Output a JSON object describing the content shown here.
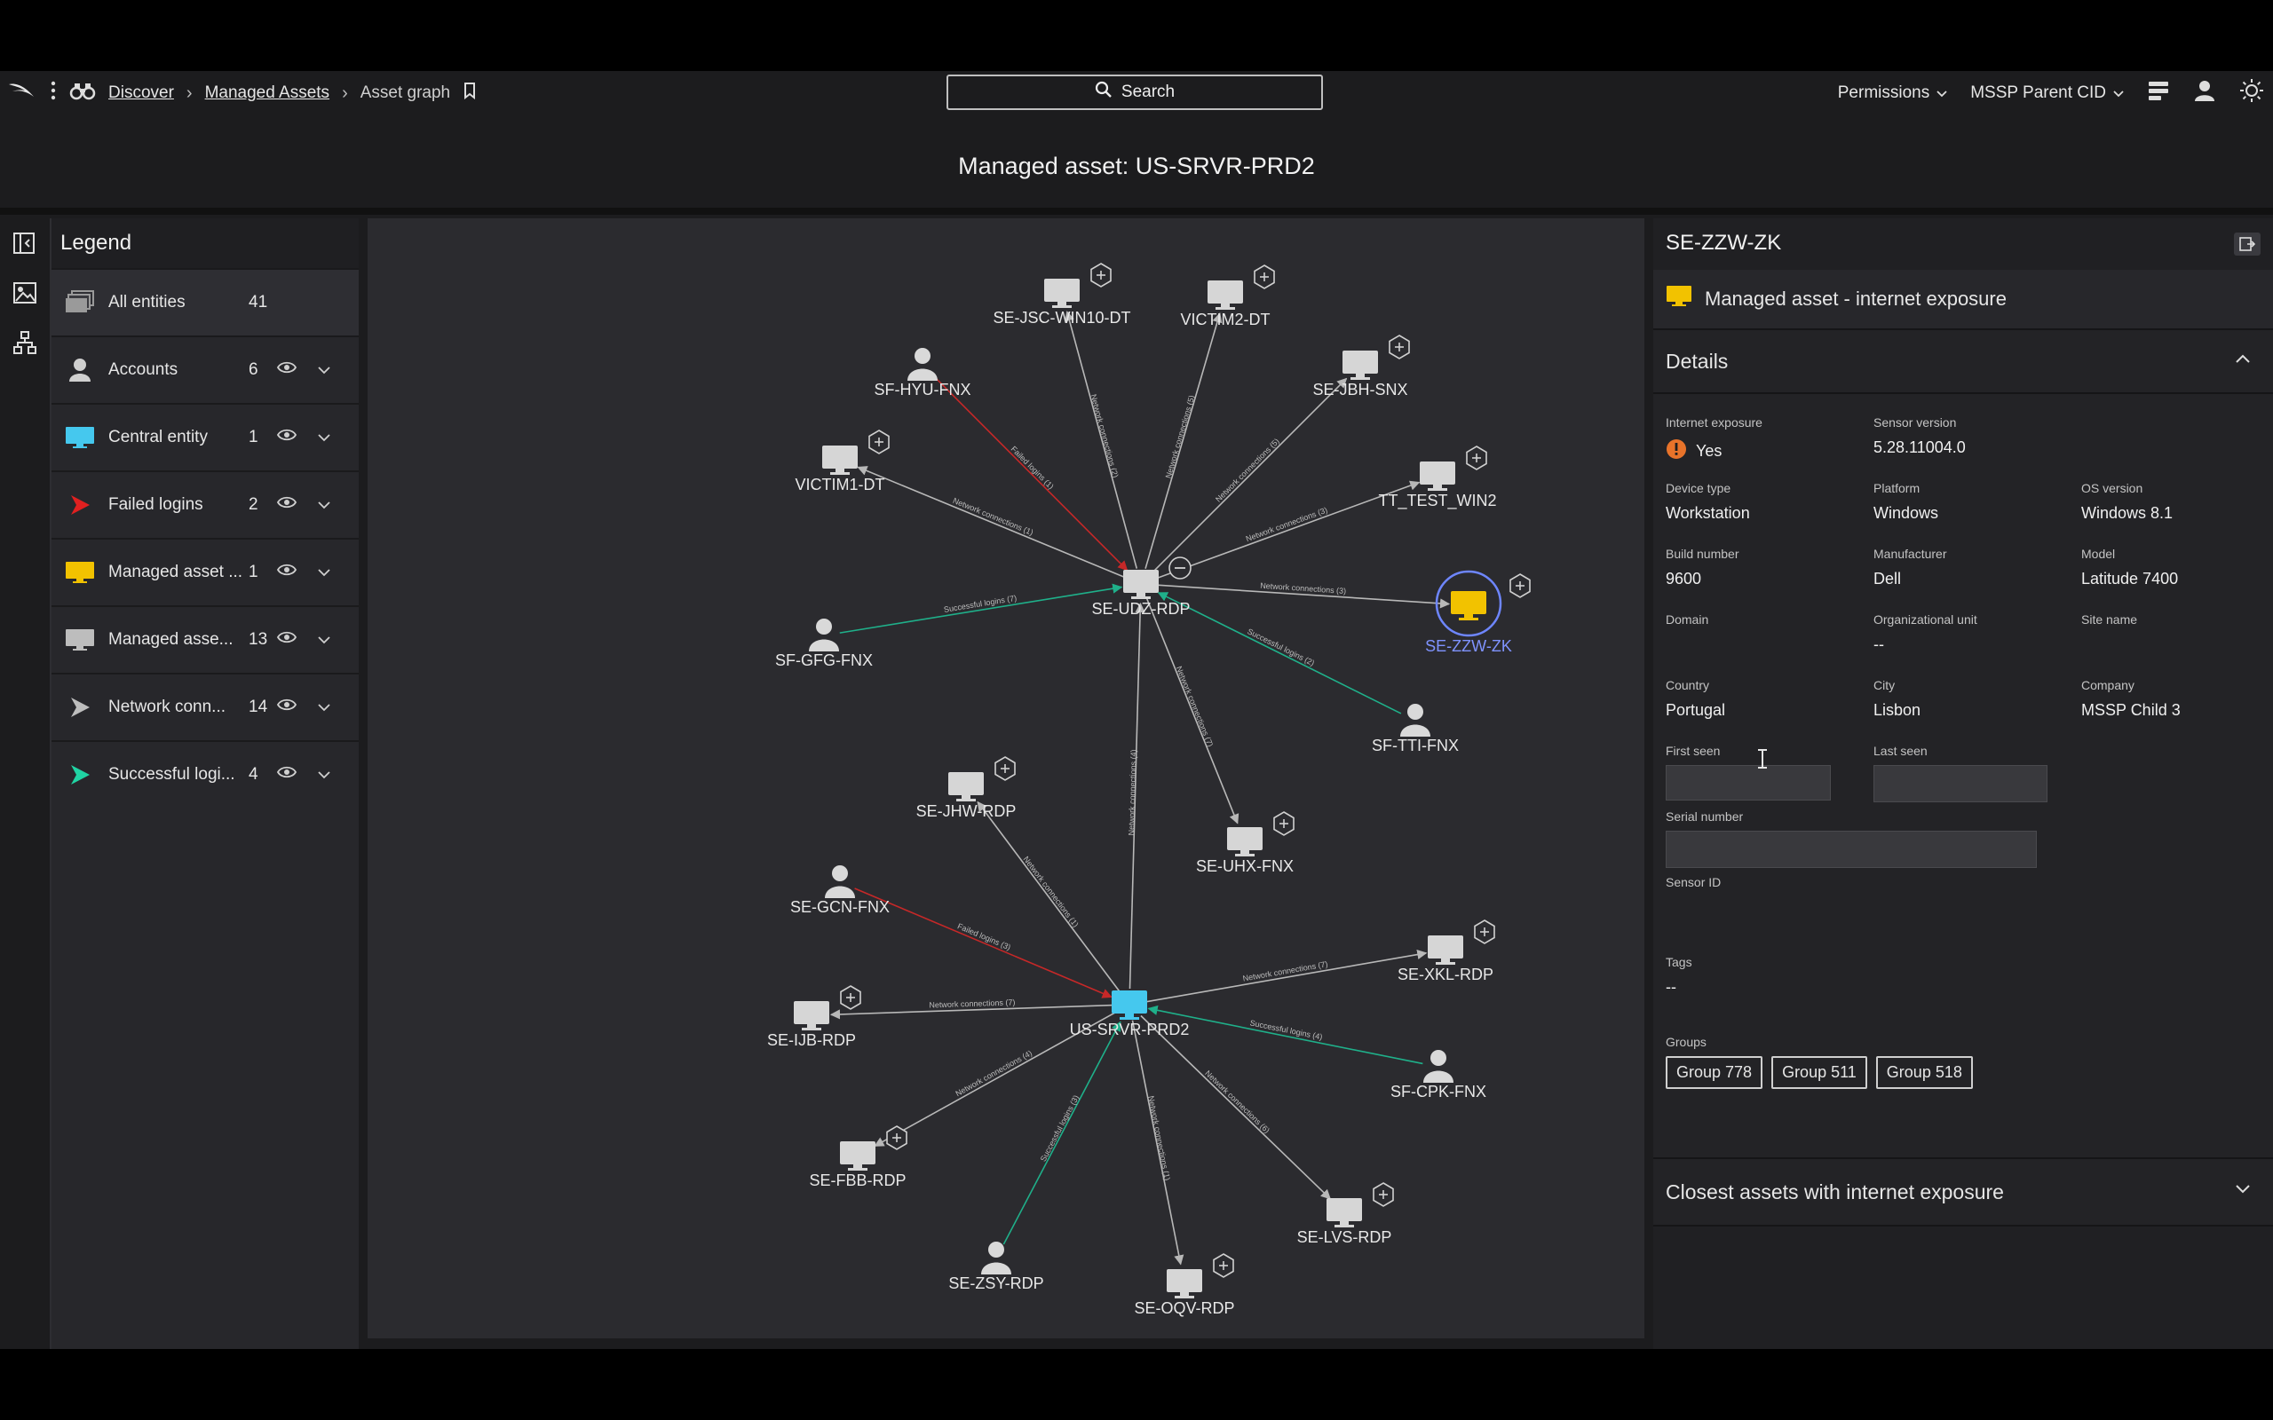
{
  "nav": {
    "breadcrumb": [
      "Discover",
      "Managed Assets",
      "Asset graph"
    ],
    "search_label": "Search",
    "permissions": "Permissions",
    "cid": "MSSP Parent CID"
  },
  "page_title": "Managed asset: US-SRVR-PRD2",
  "legend": {
    "title": "Legend",
    "rows": [
      {
        "label": "All entities",
        "count": "41",
        "icon": "all-entities-icon",
        "color": "#9a9a9a"
      },
      {
        "label": "Accounts",
        "count": "6",
        "icon": "account-icon",
        "color": "#cfcfcf"
      },
      {
        "label": "Central entity",
        "count": "1",
        "icon": "monitor-icon",
        "color": "#45c8ee"
      },
      {
        "label": "Failed logins",
        "count": "2",
        "icon": "arrow-icon",
        "color": "#e02020"
      },
      {
        "label": "Managed asset ...",
        "count": "1",
        "icon": "monitor-icon",
        "color": "#f2c200"
      },
      {
        "label": "Managed asse...",
        "count": "13",
        "icon": "monitor-icon",
        "color": "#bdbdbd"
      },
      {
        "label": "Network conn...",
        "count": "14",
        "icon": "arrow-icon",
        "color": "#bdbdbd"
      },
      {
        "label": "Successful logi...",
        "count": "4",
        "icon": "arrow-icon",
        "color": "#20d3a3"
      }
    ]
  },
  "graph": {
    "colors": {
      "network": "#b8b8b8",
      "failed": "#c62828",
      "success": "#1fb08a",
      "central": "#45c8ee",
      "exposed": "#f2c200"
    },
    "nodes": [
      {
        "id": "SE-JSC-WIN10-DT",
        "kind": "asset",
        "plus": true
      },
      {
        "id": "VICTIM2-DT",
        "kind": "asset",
        "plus": true
      },
      {
        "id": "SF-HYU-FNX",
        "kind": "account",
        "plus": false
      },
      {
        "id": "SE-JBH-SNX",
        "kind": "asset",
        "plus": true
      },
      {
        "id": "VICTIM1-DT",
        "kind": "asset",
        "plus": true
      },
      {
        "id": "TT_TEST_WIN2",
        "kind": "asset",
        "plus": true
      },
      {
        "id": "SE-UDZ-RDP",
        "kind": "hub",
        "plus": false
      },
      {
        "id": "SE-ZZW-ZK",
        "kind": "exposed",
        "plus": true
      },
      {
        "id": "SF-GFG-FNX",
        "kind": "account",
        "plus": false
      },
      {
        "id": "SF-TTI-FNX",
        "kind": "account",
        "plus": false
      },
      {
        "id": "SE-JHW-RDP",
        "kind": "asset",
        "plus": true
      },
      {
        "id": "SE-UHX-FNX",
        "kind": "asset",
        "plus": true
      },
      {
        "id": "SE-GCN-FNX",
        "kind": "account",
        "plus": false
      },
      {
        "id": "SE-XKL-RDP",
        "kind": "asset",
        "plus": true
      },
      {
        "id": "US-SRVR-PRD2",
        "kind": "central",
        "plus": false
      },
      {
        "id": "SE-IJB-RDP",
        "kind": "asset",
        "plus": true
      },
      {
        "id": "SF-CPK-FNX",
        "kind": "account",
        "plus": false
      },
      {
        "id": "SE-FBB-RDP",
        "kind": "asset",
        "plus": true
      },
      {
        "id": "SE-LVS-RDP",
        "kind": "asset",
        "plus": true
      },
      {
        "id": "SE-ZSY-RDP",
        "kind": "account",
        "plus": false
      },
      {
        "id": "SE-OQV-RDP",
        "kind": "asset",
        "plus": true
      }
    ],
    "edges": [
      {
        "from": "SE-UDZ-RDP",
        "to": "SE-JSC-WIN10-DT",
        "type": "network",
        "label": "Network connections (2)"
      },
      {
        "from": "SE-UDZ-RDP",
        "to": "VICTIM2-DT",
        "type": "network",
        "label": "Network connections (5)"
      },
      {
        "from": "SF-HYU-FNX",
        "to": "SE-UDZ-RDP",
        "type": "failed",
        "label": "Failed logins (1)"
      },
      {
        "from": "SE-UDZ-RDP",
        "to": "SE-JBH-SNX",
        "type": "network",
        "label": "Network connections (5)"
      },
      {
        "from": "SE-UDZ-RDP",
        "to": "TT_TEST_WIN2",
        "type": "network",
        "label": "Network connections (3)"
      },
      {
        "from": "SE-UDZ-RDP",
        "to": "VICTIM1-DT",
        "type": "network",
        "label": "Network connections (1)"
      },
      {
        "from": "SE-UDZ-RDP",
        "to": "SE-ZZW-ZK",
        "type": "network",
        "label": "Network connections (3)"
      },
      {
        "from": "SF-GFG-FNX",
        "to": "SE-UDZ-RDP",
        "type": "success",
        "label": "Successful logins (7)"
      },
      {
        "from": "SF-TTI-FNX",
        "to": "SE-UDZ-RDP",
        "type": "success",
        "label": "Successful logins (2)"
      },
      {
        "from": "SE-UDZ-RDP",
        "to": "SE-UHX-FNX",
        "type": "network",
        "label": "Network connections (7)"
      },
      {
        "from": "US-SRVR-PRD2",
        "to": "SE-UDZ-RDP",
        "type": "network",
        "label": "Network connections (4)"
      },
      {
        "from": "US-SRVR-PRD2",
        "to": "SE-JHW-RDP",
        "type": "network",
        "label": "Network connections (1)"
      },
      {
        "from": "SE-GCN-FNX",
        "to": "US-SRVR-PRD2",
        "type": "failed",
        "label": "Failed logins (3)"
      },
      {
        "from": "US-SRVR-PRD2",
        "to": "SE-XKL-RDP",
        "type": "network",
        "label": "Network connections (7)"
      },
      {
        "from": "US-SRVR-PRD2",
        "to": "SE-IJB-RDP",
        "type": "network",
        "label": "Network connections (7)"
      },
      {
        "from": "SF-CPK-FNX",
        "to": "US-SRVR-PRD2",
        "type": "success",
        "label": "Successful logins (4)"
      },
      {
        "from": "US-SRVR-PRD2",
        "to": "SE-FBB-RDP",
        "type": "network",
        "label": "Network connections (4)"
      },
      {
        "from": "US-SRVR-PRD2",
        "to": "SE-LVS-RDP",
        "type": "network",
        "label": "Network connections (6)"
      },
      {
        "from": "SE-ZSY-RDP",
        "to": "US-SRVR-PRD2",
        "type": "success",
        "label": "Successful logins (3)"
      },
      {
        "from": "US-SRVR-PRD2",
        "to": "SE-OQV-RDP",
        "type": "network",
        "label": "Network connections (1)"
      }
    ]
  },
  "panel": {
    "title": "SE-ZZW-ZK",
    "type_label": "Managed asset - internet exposure",
    "details_title": "Details",
    "fields": {
      "internet_exposure": {
        "label": "Internet exposure",
        "value": "Yes"
      },
      "sensor_version": {
        "label": "Sensor version",
        "value": "5.28.11004.0"
      },
      "device_type": {
        "label": "Device type",
        "value": "Workstation"
      },
      "platform": {
        "label": "Platform",
        "value": "Windows"
      },
      "os_version": {
        "label": "OS version",
        "value": "Windows 8.1"
      },
      "build_number": {
        "label": "Build number",
        "value": "9600"
      },
      "manufacturer": {
        "label": "Manufacturer",
        "value": "Dell"
      },
      "model": {
        "label": "Model",
        "value": "Latitude 7400"
      },
      "domain": {
        "label": "Domain",
        "value": ""
      },
      "org_unit": {
        "label": "Organizational unit",
        "value": "--"
      },
      "site_name": {
        "label": "Site name",
        "value": ""
      },
      "country": {
        "label": "Country",
        "value": "Portugal"
      },
      "city": {
        "label": "City",
        "value": "Lisbon"
      },
      "company": {
        "label": "Company",
        "value": "MSSP Child 3"
      },
      "first_seen": {
        "label": "First seen",
        "value": ""
      },
      "last_seen": {
        "label": "Last seen",
        "value": ""
      },
      "serial_number": {
        "label": "Serial number",
        "value": ""
      },
      "sensor_id": {
        "label": "Sensor ID",
        "value": ""
      },
      "tags": {
        "label": "Tags",
        "value": "--"
      },
      "groups": {
        "label": "Groups",
        "values": [
          "Group 778",
          "Group 511",
          "Group 518"
        ]
      }
    },
    "closest_title": "Closest assets with internet exposure"
  }
}
